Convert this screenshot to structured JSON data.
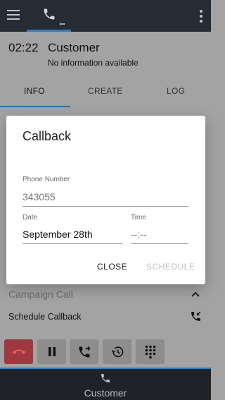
{
  "topbar": {
    "tab_dots": "..."
  },
  "call": {
    "timer": "02:22",
    "contact_name": "Customer",
    "info": "No information available"
  },
  "tabs": [
    {
      "label": "INFO",
      "active": true
    },
    {
      "label": "CREATE",
      "active": false
    },
    {
      "label": "LOG",
      "active": false
    }
  ],
  "campaign": {
    "title": "Campaign Call",
    "schedule_label": "Schedule Callback"
  },
  "call_actions": [
    {
      "name": "end-call",
      "icon": "phone-hangup-icon"
    },
    {
      "name": "hold",
      "icon": "pause-icon"
    },
    {
      "name": "transfer",
      "icon": "phone-forward-icon"
    },
    {
      "name": "history",
      "icon": "history-icon"
    },
    {
      "name": "dialpad",
      "icon": "dialpad-icon"
    }
  ],
  "bottom_bar": {
    "label": "Customer"
  },
  "dialog": {
    "title": "Callback",
    "phone_label": "Phone Number",
    "phone_value": "343055",
    "date_label": "Date",
    "date_value": "September 28th",
    "time_label": "Time",
    "time_value": "--:--",
    "close_label": "CLOSE",
    "schedule_label": "SCHEDULE"
  },
  "colors": {
    "accent": "#2f7ec4",
    "end_call": "#a0393f",
    "topbar": "#262c33",
    "overlay": "#a3a3a3"
  }
}
